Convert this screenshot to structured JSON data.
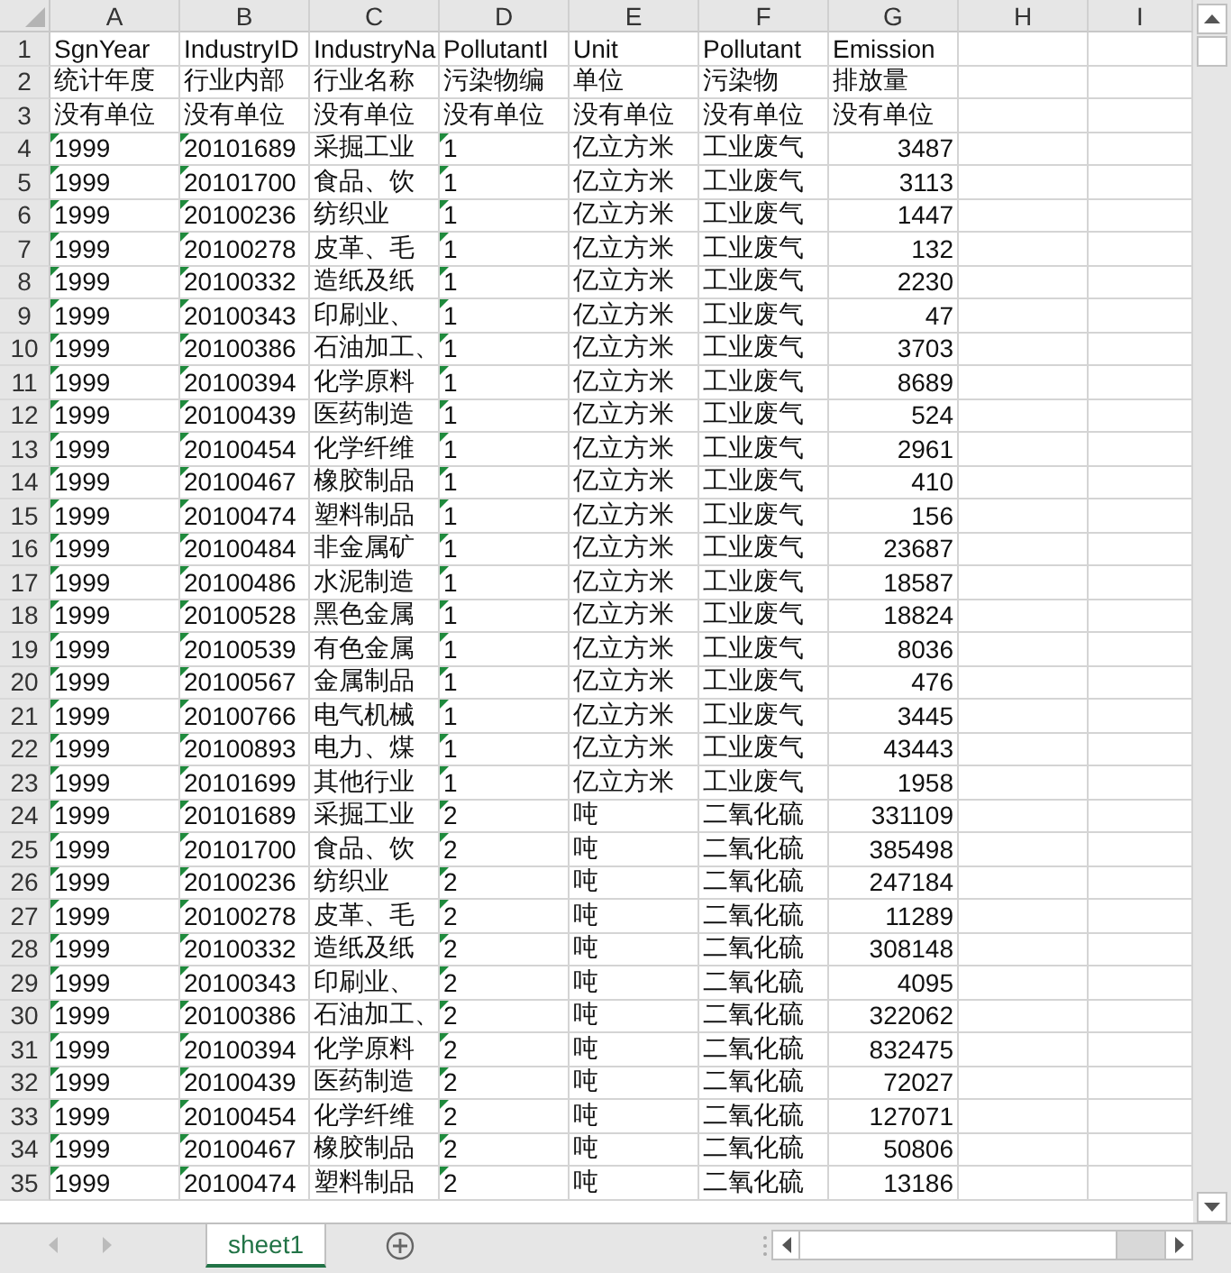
{
  "sheet": {
    "columns": [
      "A",
      "B",
      "C",
      "D",
      "E",
      "F",
      "G",
      "H",
      "I"
    ],
    "rows": [
      {
        "number": "1",
        "kind": "label",
        "cells": [
          "SgnYear",
          "IndustryID",
          "IndustryNa",
          "PollutantI",
          "Unit",
          "Pollutant",
          "Emission"
        ],
        "flags": [
          false,
          false,
          false,
          false,
          false,
          false,
          false
        ]
      },
      {
        "number": "2",
        "kind": "label",
        "cells": [
          "统计年度",
          "行业内部",
          "行业名称",
          "污染物编",
          "单位",
          "污染物",
          "排放量"
        ],
        "flags": [
          false,
          false,
          false,
          false,
          false,
          false,
          false
        ]
      },
      {
        "number": "3",
        "kind": "label",
        "cells": [
          "没有单位",
          "没有单位",
          "没有单位",
          "没有单位",
          "没有单位",
          "没有单位",
          "没有单位"
        ],
        "flags": [
          false,
          false,
          false,
          false,
          false,
          false,
          false
        ]
      },
      {
        "number": "4",
        "kind": "data",
        "cells": [
          "1999",
          "20101689",
          "采掘工业",
          "1",
          "亿立方米",
          "工业废气",
          "3487"
        ],
        "flags": [
          true,
          true,
          false,
          true,
          false,
          false,
          false
        ]
      },
      {
        "number": "5",
        "kind": "data",
        "cells": [
          "1999",
          "20101700",
          "食品、饮",
          "1",
          "亿立方米",
          "工业废气",
          "3113"
        ],
        "flags": [
          true,
          true,
          false,
          true,
          false,
          false,
          false
        ]
      },
      {
        "number": "6",
        "kind": "data",
        "cells": [
          "1999",
          "20100236",
          "纺织业",
          "1",
          "亿立方米",
          "工业废气",
          "1447"
        ],
        "flags": [
          true,
          true,
          false,
          true,
          false,
          false,
          false
        ]
      },
      {
        "number": "7",
        "kind": "data",
        "cells": [
          "1999",
          "20100278",
          "皮革、毛",
          "1",
          "亿立方米",
          "工业废气",
          "132"
        ],
        "flags": [
          true,
          true,
          false,
          true,
          false,
          false,
          false
        ]
      },
      {
        "number": "8",
        "kind": "data",
        "cells": [
          "1999",
          "20100332",
          "造纸及纸",
          "1",
          "亿立方米",
          "工业废气",
          "2230"
        ],
        "flags": [
          true,
          true,
          false,
          true,
          false,
          false,
          false
        ]
      },
      {
        "number": "9",
        "kind": "data",
        "cells": [
          "1999",
          "20100343",
          "印刷业、",
          "1",
          "亿立方米",
          "工业废气",
          "47"
        ],
        "flags": [
          true,
          true,
          false,
          true,
          false,
          false,
          false
        ]
      },
      {
        "number": "10",
        "kind": "data",
        "cells": [
          "1999",
          "20100386",
          "石油加工、",
          "1",
          "亿立方米",
          "工业废气",
          "3703"
        ],
        "flags": [
          true,
          true,
          false,
          true,
          false,
          false,
          false
        ]
      },
      {
        "number": "11",
        "kind": "data",
        "cells": [
          "1999",
          "20100394",
          "化学原料",
          "1",
          "亿立方米",
          "工业废气",
          "8689"
        ],
        "flags": [
          true,
          true,
          false,
          true,
          false,
          false,
          false
        ]
      },
      {
        "number": "12",
        "kind": "data",
        "cells": [
          "1999",
          "20100439",
          "医药制造",
          "1",
          "亿立方米",
          "工业废气",
          "524"
        ],
        "flags": [
          true,
          true,
          false,
          true,
          false,
          false,
          false
        ]
      },
      {
        "number": "13",
        "kind": "data",
        "cells": [
          "1999",
          "20100454",
          "化学纤维",
          "1",
          "亿立方米",
          "工业废气",
          "2961"
        ],
        "flags": [
          true,
          true,
          false,
          true,
          false,
          false,
          false
        ]
      },
      {
        "number": "14",
        "kind": "data",
        "cells": [
          "1999",
          "20100467",
          "橡胶制品",
          "1",
          "亿立方米",
          "工业废气",
          "410"
        ],
        "flags": [
          true,
          true,
          false,
          true,
          false,
          false,
          false
        ]
      },
      {
        "number": "15",
        "kind": "data",
        "cells": [
          "1999",
          "20100474",
          "塑料制品",
          "1",
          "亿立方米",
          "工业废气",
          "156"
        ],
        "flags": [
          true,
          true,
          false,
          true,
          false,
          false,
          false
        ]
      },
      {
        "number": "16",
        "kind": "data",
        "cells": [
          "1999",
          "20100484",
          "非金属矿",
          "1",
          "亿立方米",
          "工业废气",
          "23687"
        ],
        "flags": [
          true,
          true,
          false,
          true,
          false,
          false,
          false
        ]
      },
      {
        "number": "17",
        "kind": "data",
        "cells": [
          "1999",
          "20100486",
          "水泥制造",
          "1",
          "亿立方米",
          "工业废气",
          "18587"
        ],
        "flags": [
          true,
          true,
          false,
          true,
          false,
          false,
          false
        ]
      },
      {
        "number": "18",
        "kind": "data",
        "cells": [
          "1999",
          "20100528",
          "黑色金属",
          "1",
          "亿立方米",
          "工业废气",
          "18824"
        ],
        "flags": [
          true,
          true,
          false,
          true,
          false,
          false,
          false
        ]
      },
      {
        "number": "19",
        "kind": "data",
        "cells": [
          "1999",
          "20100539",
          "有色金属",
          "1",
          "亿立方米",
          "工业废气",
          "8036"
        ],
        "flags": [
          true,
          true,
          false,
          true,
          false,
          false,
          false
        ]
      },
      {
        "number": "20",
        "kind": "data",
        "cells": [
          "1999",
          "20100567",
          "金属制品",
          "1",
          "亿立方米",
          "工业废气",
          "476"
        ],
        "flags": [
          true,
          true,
          false,
          true,
          false,
          false,
          false
        ]
      },
      {
        "number": "21",
        "kind": "data",
        "cells": [
          "1999",
          "20100766",
          "电气机械",
          "1",
          "亿立方米",
          "工业废气",
          "3445"
        ],
        "flags": [
          true,
          true,
          false,
          true,
          false,
          false,
          false
        ]
      },
      {
        "number": "22",
        "kind": "data",
        "cells": [
          "1999",
          "20100893",
          "电力、煤",
          "1",
          "亿立方米",
          "工业废气",
          "43443"
        ],
        "flags": [
          true,
          true,
          false,
          true,
          false,
          false,
          false
        ]
      },
      {
        "number": "23",
        "kind": "data",
        "cells": [
          "1999",
          "20101699",
          "其他行业",
          "1",
          "亿立方米",
          "工业废气",
          "1958"
        ],
        "flags": [
          true,
          true,
          false,
          true,
          false,
          false,
          false
        ]
      },
      {
        "number": "24",
        "kind": "data",
        "cells": [
          "1999",
          "20101689",
          "采掘工业",
          "2",
          "吨",
          "二氧化硫",
          "331109"
        ],
        "flags": [
          true,
          true,
          false,
          true,
          false,
          false,
          false
        ]
      },
      {
        "number": "25",
        "kind": "data",
        "cells": [
          "1999",
          "20101700",
          "食品、饮",
          "2",
          "吨",
          "二氧化硫",
          "385498"
        ],
        "flags": [
          true,
          true,
          false,
          true,
          false,
          false,
          false
        ]
      },
      {
        "number": "26",
        "kind": "data",
        "cells": [
          "1999",
          "20100236",
          "纺织业",
          "2",
          "吨",
          "二氧化硫",
          "247184"
        ],
        "flags": [
          true,
          true,
          false,
          true,
          false,
          false,
          false
        ]
      },
      {
        "number": "27",
        "kind": "data",
        "cells": [
          "1999",
          "20100278",
          "皮革、毛",
          "2",
          "吨",
          "二氧化硫",
          "11289"
        ],
        "flags": [
          true,
          true,
          false,
          true,
          false,
          false,
          false
        ]
      },
      {
        "number": "28",
        "kind": "data",
        "cells": [
          "1999",
          "20100332",
          "造纸及纸",
          "2",
          "吨",
          "二氧化硫",
          "308148"
        ],
        "flags": [
          true,
          true,
          false,
          true,
          false,
          false,
          false
        ]
      },
      {
        "number": "29",
        "kind": "data",
        "cells": [
          "1999",
          "20100343",
          "印刷业、",
          "2",
          "吨",
          "二氧化硫",
          "4095"
        ],
        "flags": [
          true,
          true,
          false,
          true,
          false,
          false,
          false
        ]
      },
      {
        "number": "30",
        "kind": "data",
        "cells": [
          "1999",
          "20100386",
          "石油加工、",
          "2",
          "吨",
          "二氧化硫",
          "322062"
        ],
        "flags": [
          true,
          true,
          false,
          true,
          false,
          false,
          false
        ]
      },
      {
        "number": "31",
        "kind": "data",
        "cells": [
          "1999",
          "20100394",
          "化学原料",
          "2",
          "吨",
          "二氧化硫",
          "832475"
        ],
        "flags": [
          true,
          true,
          false,
          true,
          false,
          false,
          false
        ]
      },
      {
        "number": "32",
        "kind": "data",
        "cells": [
          "1999",
          "20100439",
          "医药制造",
          "2",
          "吨",
          "二氧化硫",
          "72027"
        ],
        "flags": [
          true,
          true,
          false,
          true,
          false,
          false,
          false
        ]
      },
      {
        "number": "33",
        "kind": "data",
        "cells": [
          "1999",
          "20100454",
          "化学纤维",
          "2",
          "吨",
          "二氧化硫",
          "127071"
        ],
        "flags": [
          true,
          true,
          false,
          true,
          false,
          false,
          false
        ]
      },
      {
        "number": "34",
        "kind": "data",
        "cells": [
          "1999",
          "20100467",
          "橡胶制品",
          "2",
          "吨",
          "二氧化硫",
          "50806"
        ],
        "flags": [
          true,
          true,
          false,
          true,
          false,
          false,
          false
        ]
      },
      {
        "number": "35",
        "kind": "data",
        "cells": [
          "1999",
          "20100474",
          "塑料制品",
          "2",
          "吨",
          "二氧化硫",
          "13186"
        ],
        "flags": [
          true,
          true,
          false,
          true,
          false,
          false,
          false
        ]
      }
    ]
  },
  "sheet_tabs": [
    {
      "label": "sheet1",
      "selected": true
    }
  ]
}
